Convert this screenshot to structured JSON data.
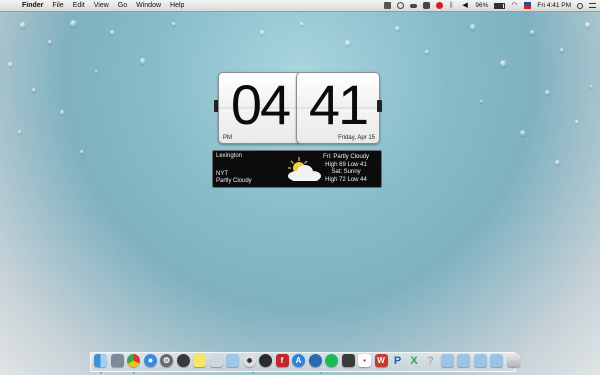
{
  "menubar": {
    "apple_glyph": "",
    "items": [
      "Finder",
      "File",
      "Edit",
      "View",
      "Go",
      "Window",
      "Help"
    ],
    "battery": "96%",
    "time": "Fri 4:41 PM"
  },
  "clock": {
    "hours": "04",
    "minutes": "41",
    "ampm": "PM",
    "date": "Friday, Apr 15"
  },
  "weather": {
    "city": "Lexington",
    "region": "NYT",
    "condition": "Partly Cloudy",
    "icon": "partly-cloudy-icon",
    "forecast": [
      "Fri: Partly Cloudy",
      "High 69 Low 41",
      "Sat: Sunny",
      "High 72 Low 44"
    ]
  },
  "dock": {
    "apps": [
      "finder-icon",
      "launchpad-icon",
      "chrome-icon",
      "safari-icon",
      "settings-icon",
      "compass-icon",
      "notes-icon",
      "preview-icon",
      "mail-icon",
      "eye-icon",
      "dvd-icon",
      "flash-icon",
      "app-store-icon",
      "sync-icon",
      "spotify-icon",
      "activity-monitor-icon",
      "calendar-icon",
      "word-icon",
      "powerpoint-icon",
      "excel-icon",
      "help-icon",
      "folder-icon",
      "downloads-icon",
      "documents-icon",
      "applications-icon",
      "trash-icon"
    ]
  }
}
